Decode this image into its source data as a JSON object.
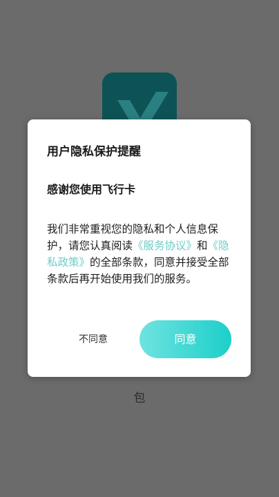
{
  "background": {
    "footer_text": "包"
  },
  "dialog": {
    "title": "用户隐私保护提醒",
    "subtitle": "感谢您使用飞行卡",
    "body_part1": "我们非常重视您的隐私和个人信息保护，请您认真阅读",
    "link_service": "《服务协议》",
    "body_and": "和",
    "link_privacy": "《隐私政策》",
    "body_part2": "的全部条款，同意并接受全部条款后再开始使用我们的服务。",
    "disagree_label": "不同意",
    "agree_label": "同意"
  },
  "colors": {
    "link": "#6ccdc9",
    "agree_start": "#6fe3e0",
    "agree_end": "#1ccfca",
    "logo_bg": "#0d5356"
  }
}
